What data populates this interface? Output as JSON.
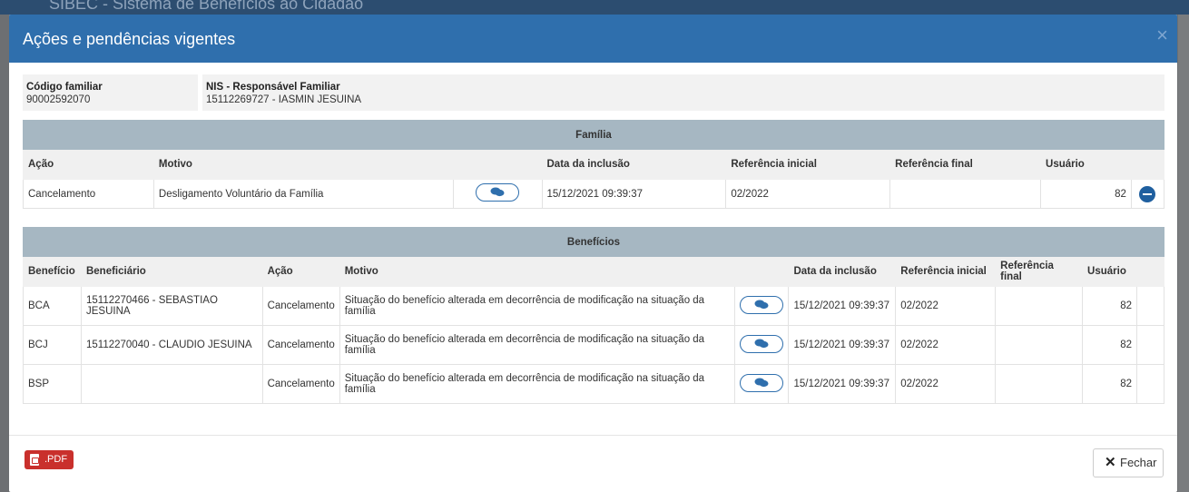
{
  "backdrop": {
    "app_title": "SIBEC - Sistema de Benefícios ao Cidadão"
  },
  "modal": {
    "title": "Ações e pendências vigentes",
    "close_glyph": "×"
  },
  "info": {
    "codigo_label": "Código familiar",
    "codigo_value": "90002592070",
    "nis_label": "NIS - Responsável Familiar",
    "nis_value": "15112269727 - IASMIN JESUINA"
  },
  "familia": {
    "caption": "Família",
    "headers": [
      "Ação",
      "Motivo",
      "",
      "Data da inclusão",
      "Referência inicial",
      "Referência final",
      "Usuário",
      ""
    ],
    "row": {
      "acao": "Cancelamento",
      "motivo": "Desligamento Voluntário da Família",
      "data": "15/12/2021 09:39:37",
      "ref_inicial": "02/2022",
      "ref_final": "",
      "usuario": "82"
    }
  },
  "beneficios": {
    "caption": "Benefícios",
    "headers": [
      "Benefício",
      "Beneficiário",
      "Ação",
      "Motivo",
      "",
      "Data da inclusão",
      "Referência inicial",
      "Referência final",
      "Usuário",
      ""
    ],
    "rows": [
      {
        "beneficio": "BCA",
        "beneficiario": "15112270466 - SEBASTIAO JESUINA",
        "acao": "Cancelamento",
        "motivo": "Situação do benefício alterada em decorrência de modificação na situação da família",
        "data": "15/12/2021 09:39:37",
        "ref_inicial": "02/2022",
        "ref_final": "",
        "usuario": "82"
      },
      {
        "beneficio": "BCJ",
        "beneficiario": "15112270040 - CLAUDIO JESUINA",
        "acao": "Cancelamento",
        "motivo": "Situação do benefício alterada em decorrência de modificação na situação da família",
        "data": "15/12/2021 09:39:37",
        "ref_inicial": "02/2022",
        "ref_final": "",
        "usuario": "82"
      },
      {
        "beneficio": "BSP",
        "beneficiario": "",
        "acao": "Cancelamento",
        "motivo": "Situação do benefício alterada em decorrência de modificação na situação da família",
        "data": "15/12/2021 09:39:37",
        "ref_inicial": "02/2022",
        "ref_final": "",
        "usuario": "82"
      }
    ]
  },
  "footer": {
    "pdf_label": ".PDF",
    "close_label": "Fechar",
    "close_icon": "✕"
  },
  "icons": {
    "comment": "comments-icon",
    "remove": "minus-circle-icon",
    "pdf": "file-pdf-icon"
  },
  "colors": {
    "header": "#2f6fad",
    "caption": "#a6b7c2",
    "pdf": "#c9302c"
  }
}
